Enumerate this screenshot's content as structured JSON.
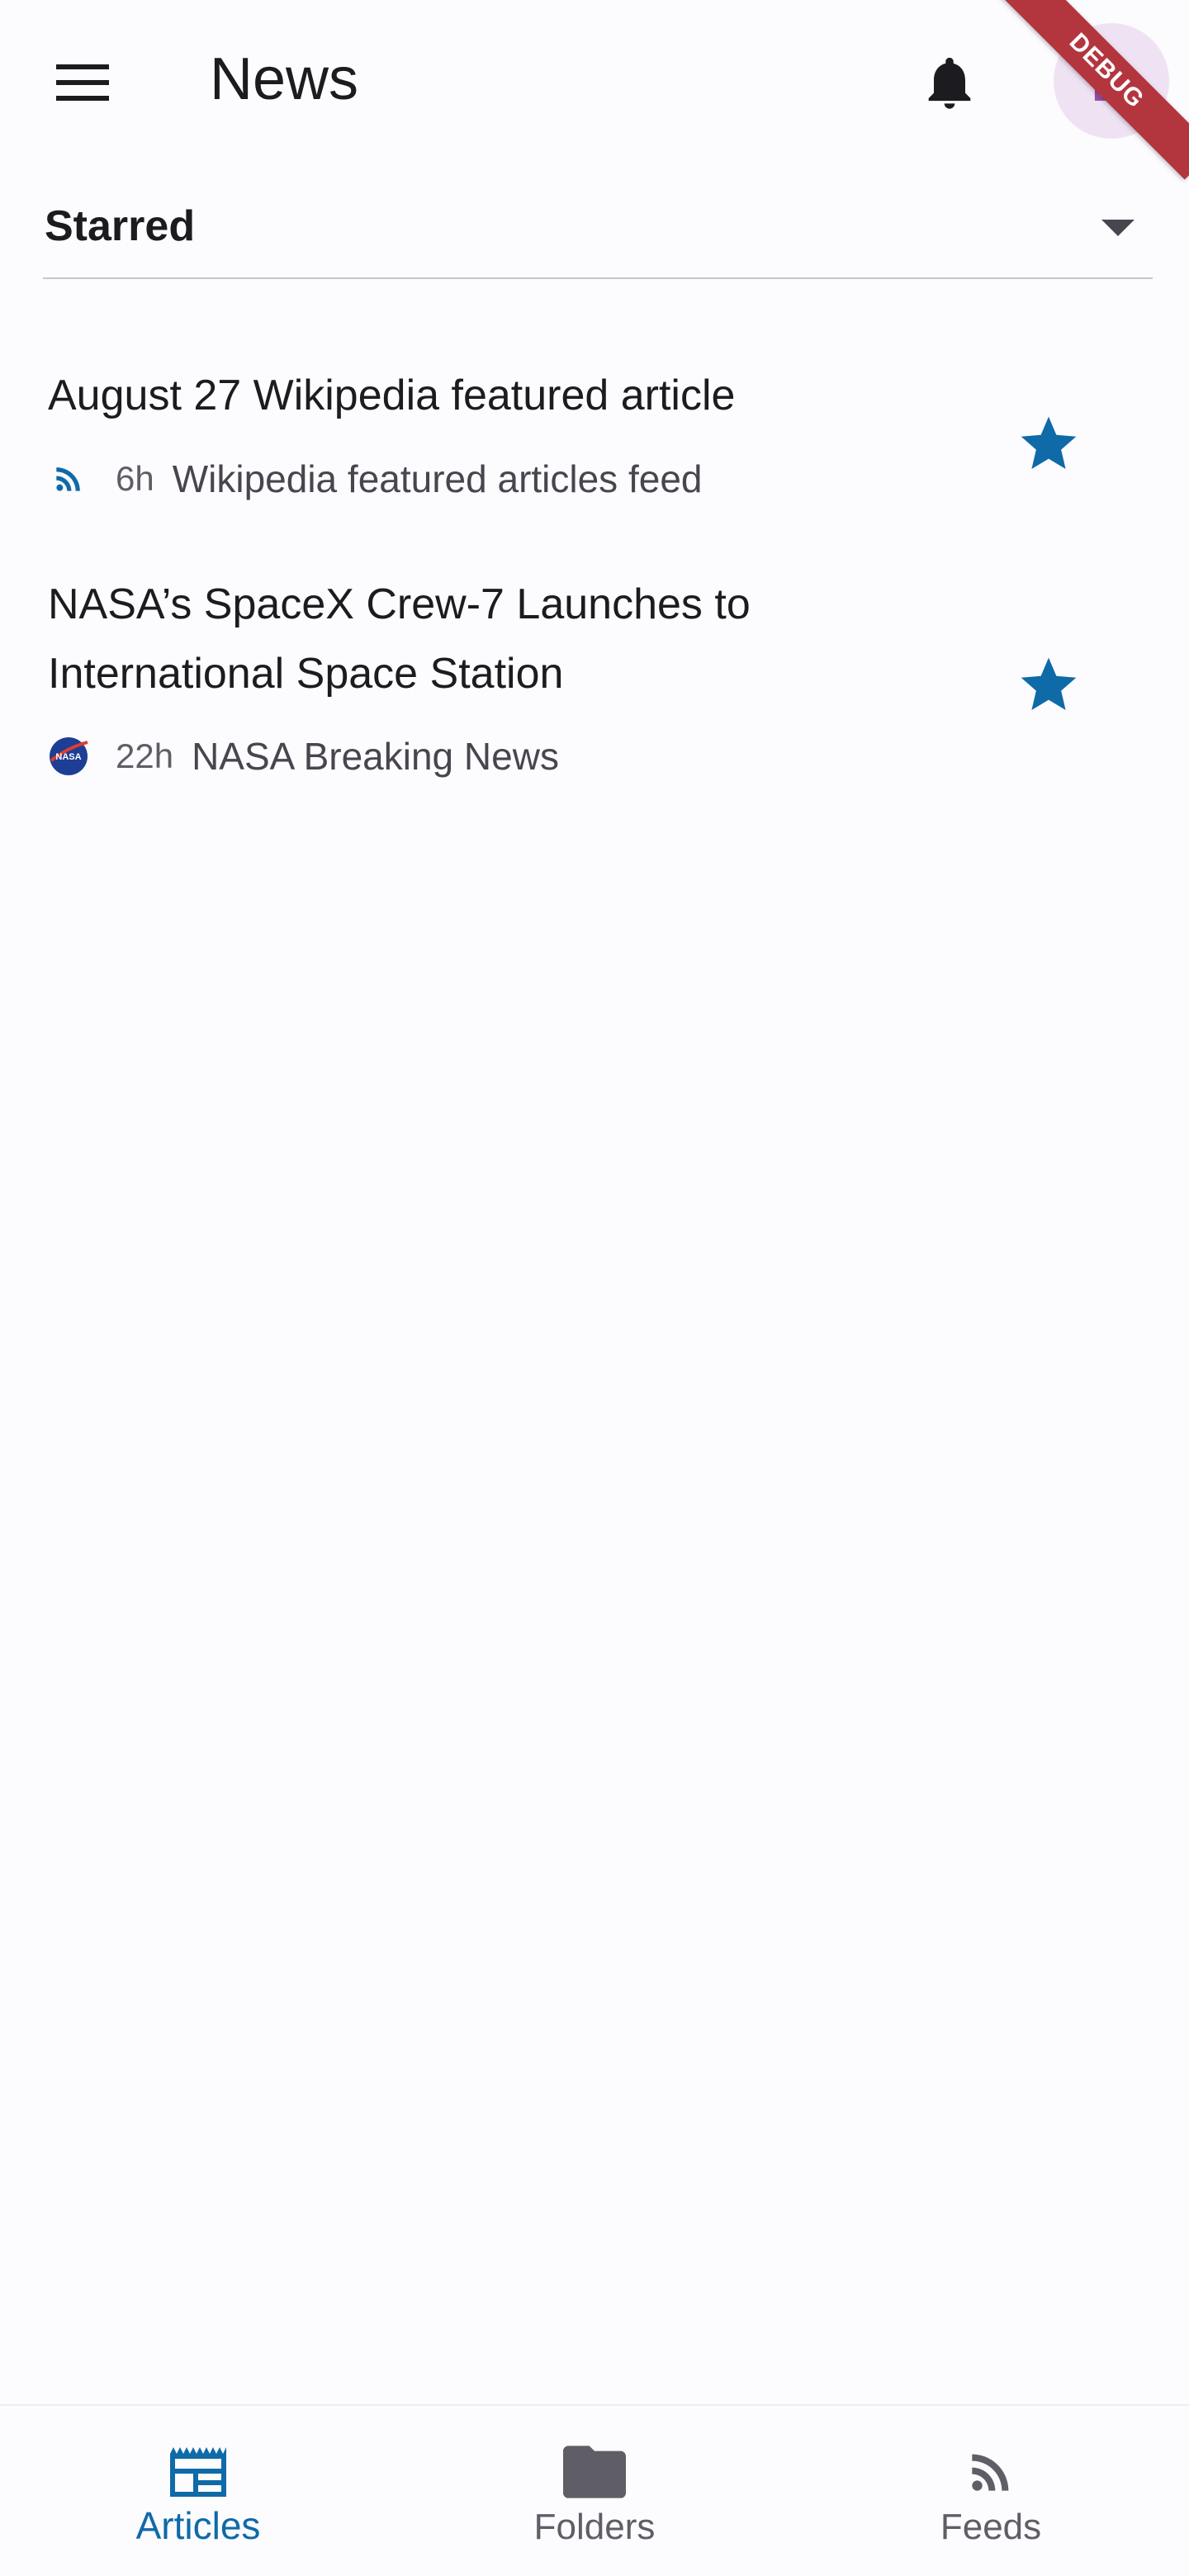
{
  "appbar": {
    "title": "News",
    "avatar_letter": "D",
    "debug_banner": "DEBUG"
  },
  "filter": {
    "selected": "Starred"
  },
  "articles": [
    {
      "title": "August 27 Wikipedia featured article",
      "age": "6h",
      "source": "Wikipedia featured articles feed",
      "source_icon": "rss-icon",
      "starred": true
    },
    {
      "title": "NASA’s SpaceX Crew-7 Launches to International Space Station",
      "age": "22h",
      "source": "NASA Breaking News",
      "source_icon": "nasa-logo",
      "source_icon_text": "NASA",
      "starred": true
    }
  ],
  "bottom_nav": {
    "items": [
      {
        "label": "Articles",
        "icon": "articles-icon",
        "active": true
      },
      {
        "label": "Folders",
        "icon": "folder-icon",
        "active": false
      },
      {
        "label": "Feeds",
        "icon": "rss-icon",
        "active": false
      }
    ]
  },
  "colors": {
    "accent": "#0f6aa8",
    "star": "#0f6aa8",
    "background": "#fcfbfe",
    "avatar_bg": "#efe3f3",
    "avatar_letter": "#9a4dab",
    "online": "#2e9b63",
    "debug_ribbon": "#b3363f"
  }
}
